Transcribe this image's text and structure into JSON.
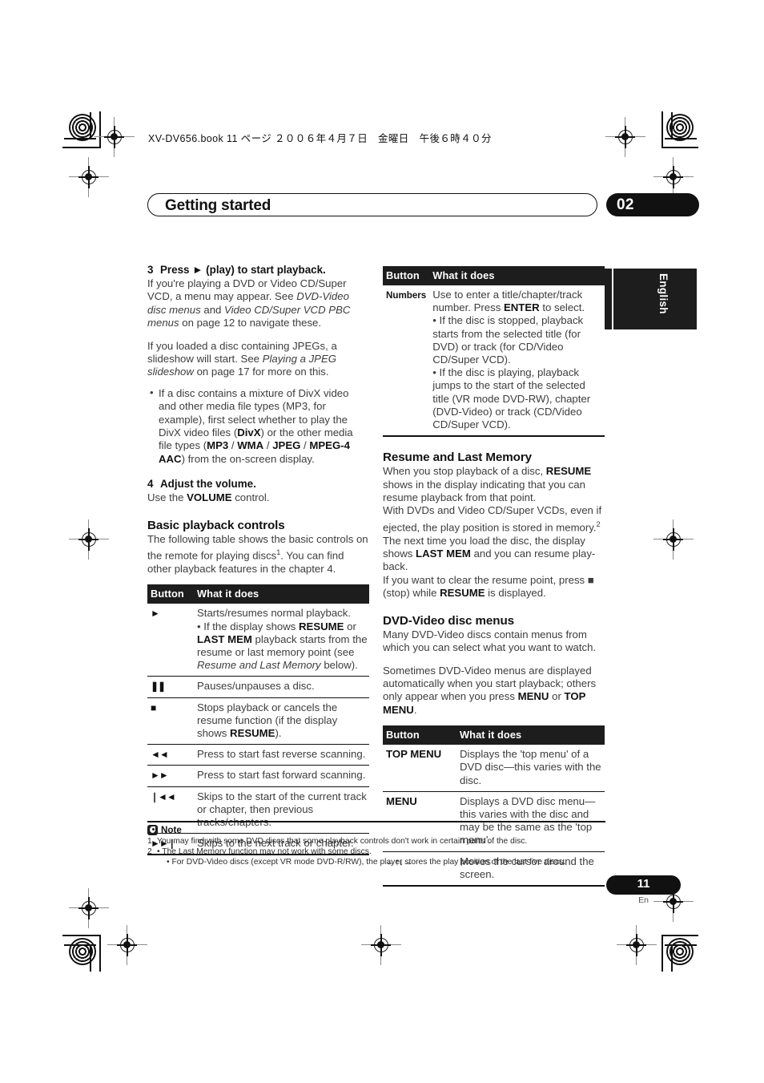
{
  "print_header": {
    "text": "XV-DV656.book  11 ページ  ２００６年４月７日　金曜日　午後６時４０分"
  },
  "chapter": {
    "title": "Getting started",
    "number": "02"
  },
  "side_tab": {
    "label": "English"
  },
  "left_column": {
    "step3": {
      "number": "3",
      "title": "Press ► (play) to start playback.",
      "p1_a": "If you're playing a DVD or Video CD/Super VCD, a menu may appear. See ",
      "p1_i1": "DVD-Video disc menus",
      "p1_b": " and ",
      "p1_i2": "Video CD/Super VCD PBC menus",
      "p1_c": " on page 12 to navigate these.",
      "p2_a": "If you loaded a disc containing JPEGs, a slideshow will start. See ",
      "p2_i1": "Playing a JPEG slideshow",
      "p2_b": " on page 17 for more on this.",
      "bullet1_a": "If a disc contains a mixture of DivX video and other media file types (MP3, for example), first select whether to play the DivX video files (",
      "bullet1_kw1": "DivX",
      "bullet1_b": ") or the other media file types (",
      "bullet1_kw2": "MP3",
      "bullet1_sep1": " / ",
      "bullet1_kw3": "WMA",
      "bullet1_sep2": " / ",
      "bullet1_kw4": "JPEG",
      "bullet1_sep3": " / ",
      "bullet1_kw5": "MPEG-4 AAC",
      "bullet1_c": ") from the on-screen display."
    },
    "step4": {
      "number": "4",
      "title": "Adjust the volume.",
      "p1_a": "Use the ",
      "p1_kw": "VOLUME",
      "p1_b": " control."
    },
    "basic_playback": {
      "heading": "Basic playback controls",
      "intro_a": "The following table shows the basic controls on the remote for playing discs",
      "intro_sup": "1",
      "intro_b": ". You can find other playback features in the chapter 4."
    },
    "table": {
      "headers": [
        "Button",
        "What it does"
      ],
      "rows": [
        {
          "button": "►",
          "button_icon": "play-icon",
          "line1": "Starts/resumes normal playback.",
          "bullet_a": "• If the display shows ",
          "bullet_kw1": "RESUME",
          "bullet_b": " or ",
          "bullet_kw2": "LAST MEM",
          "bullet_c": " playback starts from the resume or last memory point (see ",
          "bullet_i": "Resume and Last Memory",
          "bullet_d": " below)."
        },
        {
          "button": "❚❚",
          "button_icon": "pause-icon",
          "line1": "Pauses/unpauses a disc."
        },
        {
          "button": "■",
          "button_icon": "stop-icon",
          "line1_a": "Stops playback or cancels the resume function (if the display shows ",
          "line1_kw": "RESUME",
          "line1_b": ")."
        },
        {
          "button": "◄◄",
          "button_icon": "fast-reverse-icon",
          "line1": "Press to start fast reverse scanning."
        },
        {
          "button": "►►",
          "button_icon": "fast-forward-icon",
          "line1": "Press to start fast forward scanning."
        },
        {
          "button": "❘◄◄",
          "button_icon": "previous-track-icon",
          "line1": "Skips to the start of the current track or chapter, then previous tracks/chapters."
        },
        {
          "button": "►►❘",
          "button_icon": "next-track-icon",
          "line1": "Skips to the next track or chapter."
        }
      ]
    }
  },
  "right_column": {
    "numbers_table": {
      "headers": [
        "Button",
        "What it does"
      ],
      "row": {
        "button": "Numbers",
        "line1_a": "Use to enter a title/chapter/track number. Press ",
        "line1_kw": "ENTER",
        "line1_b": " to select.",
        "bullet1": "• If the disc is stopped, playback starts from the selected title (for DVD) or track (for CD/Video CD/Super VCD).",
        "bullet2": "• If the disc is playing, playback jumps to the start of the selected title (VR mode DVD-RW), chapter (DVD-Video) or track (CD/Video CD/Super VCD)."
      }
    },
    "resume": {
      "heading": "Resume and Last Memory",
      "p1_a": "When you stop playback of a disc, ",
      "p1_kw": "RESUME",
      "p1_b": " shows in the display indicating that you can resume playback from that point.",
      "p2_a": "With DVDs and Video CD/Super VCDs, even if ejected, the play position is stored in memory.",
      "p2_sup": "2",
      "p2_b": " The next time you load the disc, the display shows ",
      "p2_kw": "LAST MEM",
      "p2_c": " and you can resume play-back.",
      "p3_a": "If you want to clear the resume point, press ■ (stop) while ",
      "p3_kw": "RESUME",
      "p3_b": " is displayed."
    },
    "dvd_menus": {
      "heading": "DVD-Video disc menus",
      "p1": "Many DVD-Video discs contain menus from which you can select what you want to watch.",
      "p2_a": "Sometimes DVD-Video menus are displayed automatically when you start playback; others only appear when you press ",
      "p2_kw1": "MENU",
      "p2_b": " or ",
      "p2_kw2": "TOP MENU",
      "p2_c": "."
    },
    "menu_table": {
      "headers": [
        "Button",
        "What it does"
      ],
      "rows": [
        {
          "button": "TOP MENU",
          "button_icon": "top-menu-button",
          "desc": "Displays the 'top menu' of a DVD disc—this varies with the disc."
        },
        {
          "button": "MENU",
          "button_icon": "menu-button",
          "desc": "Displays a DVD disc menu—this varies with the disc and may be the same as the 'top menu'."
        },
        {
          "button": "←↑↓→",
          "button_icon": "cursor-arrows-icon",
          "desc": "Moves the cursor around the screen."
        }
      ]
    }
  },
  "notes": {
    "title": "Note",
    "items": [
      {
        "num": "1",
        "text": "You may find with some DVD discs that some playback controls don't work in certain parts of the disc."
      },
      {
        "num": "2",
        "text": "• The Last Memory function may not work with some discs."
      }
    ],
    "sub": "• For DVD-Video discs (except VR mode DVD-R/RW), the player stores the play position of the last five discs."
  },
  "footer": {
    "page_number": "11",
    "language_code": "En"
  }
}
